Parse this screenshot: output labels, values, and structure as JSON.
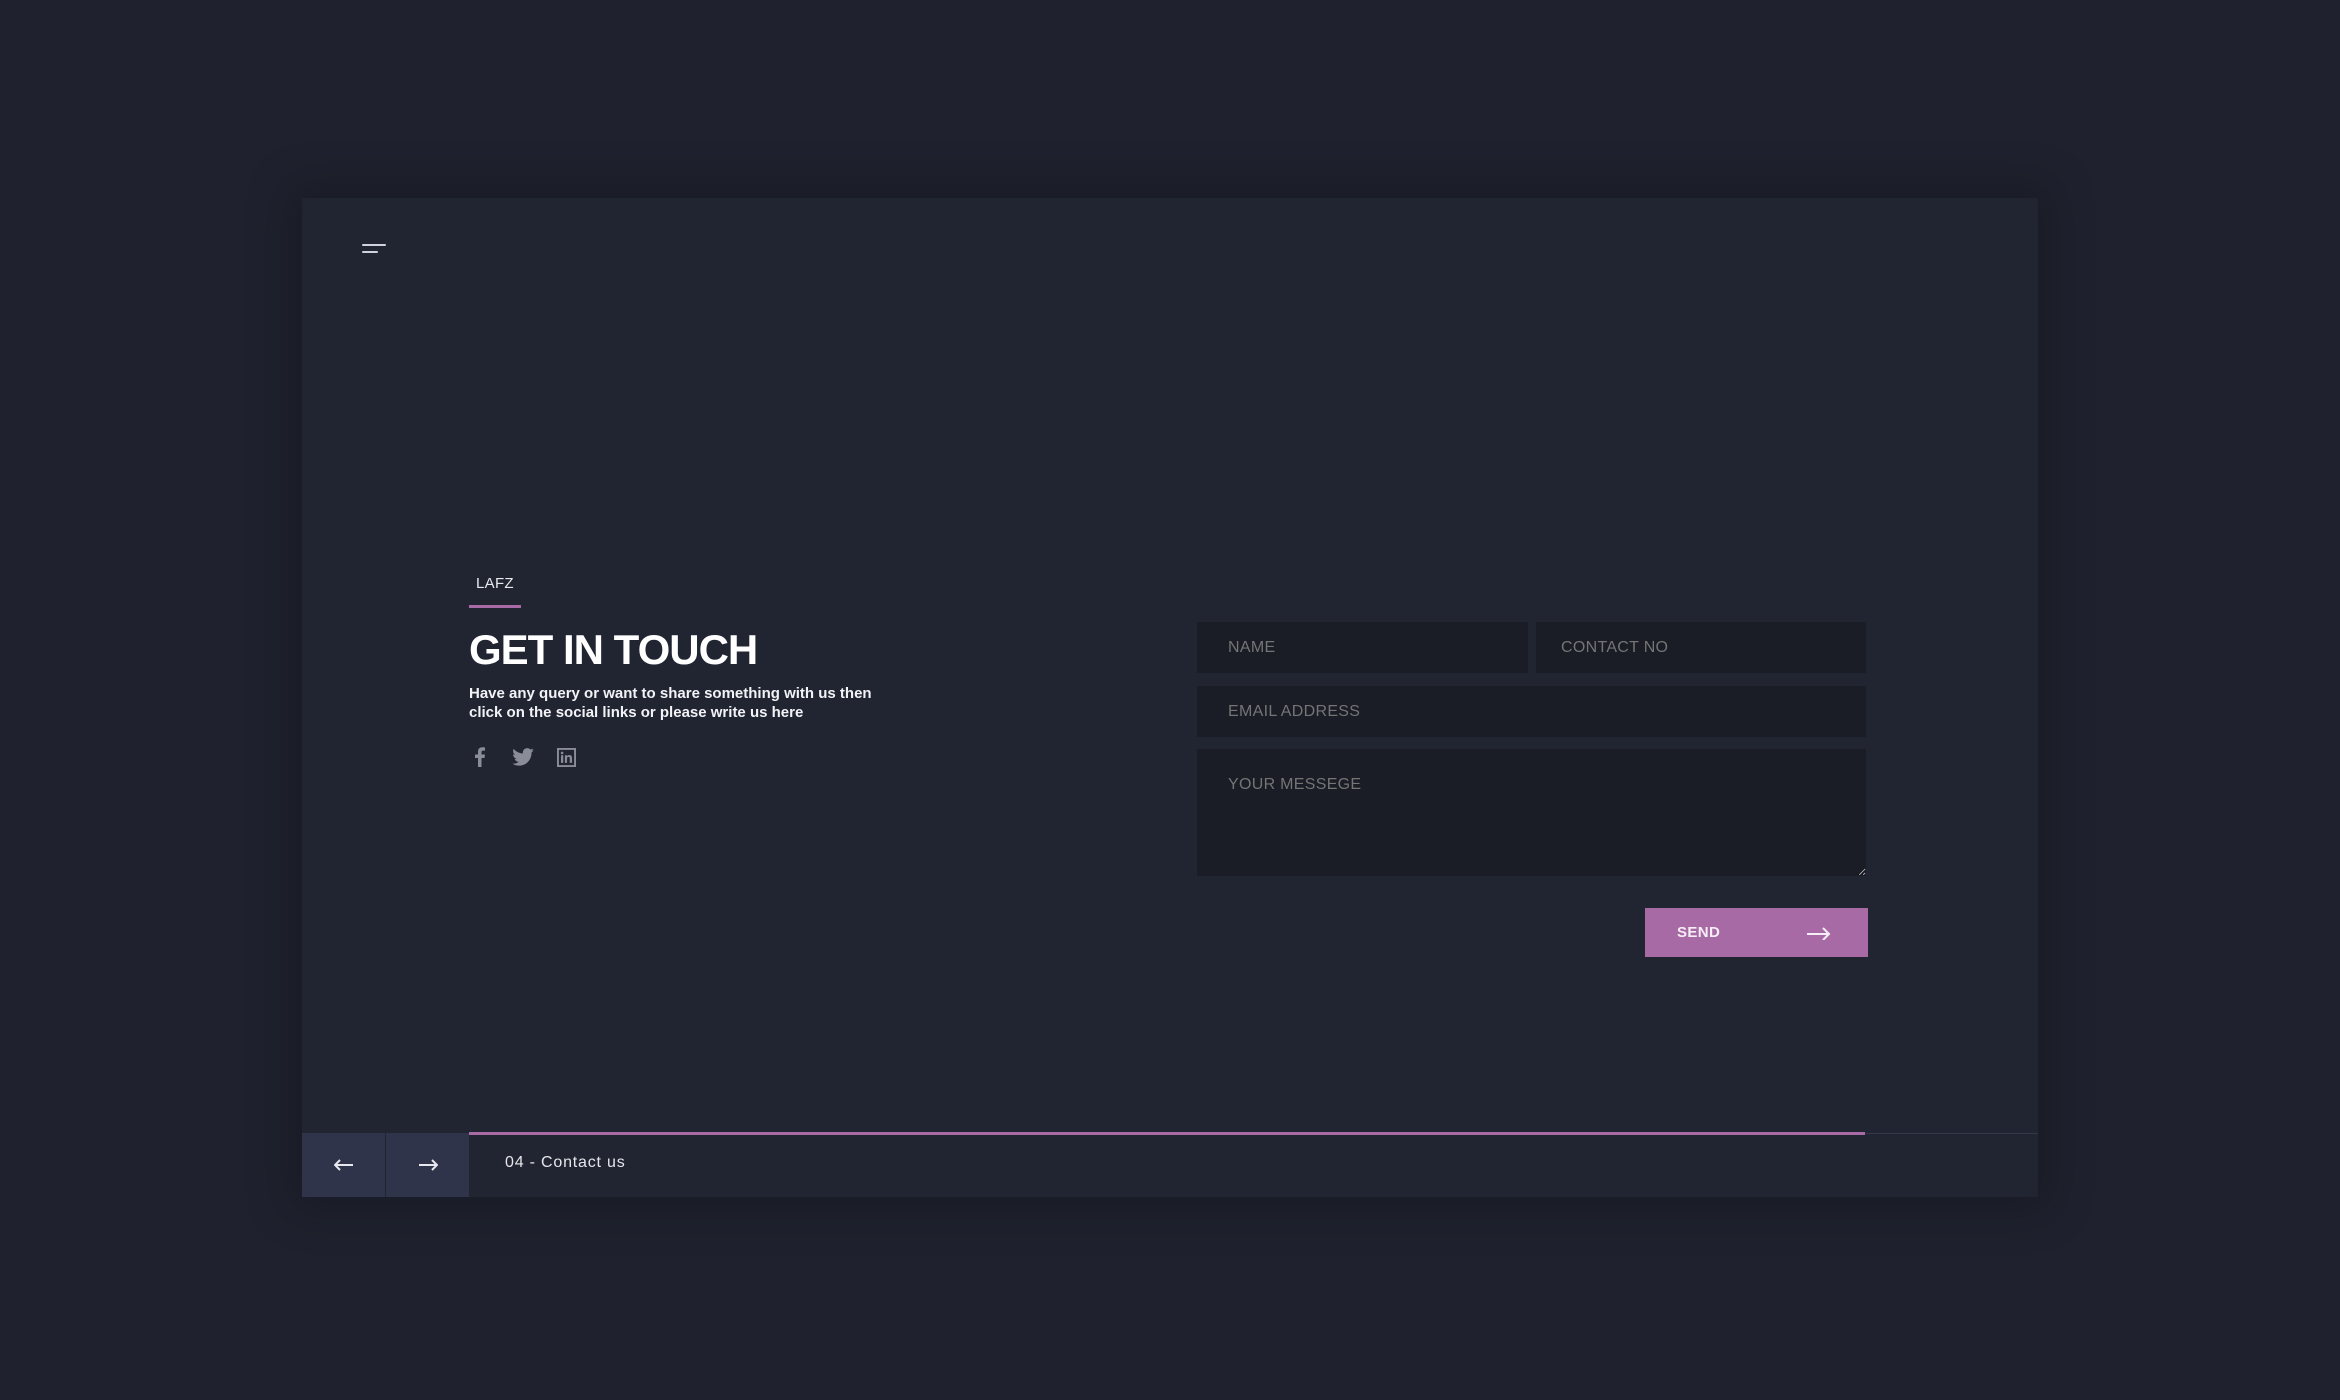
{
  "header": {
    "menu_icon": "hamburger-menu-icon"
  },
  "hero": {
    "brand": "LAFZ",
    "title": "GET IN TOUCH",
    "description_line1": "Have any query or want to share something with us then",
    "description_line2": "click on the social links or  please write us here",
    "social": [
      "facebook-icon",
      "twitter-icon",
      "linkedin-icon"
    ]
  },
  "form": {
    "name_placeholder": "NAME",
    "contact_placeholder": "CONTACT NO",
    "email_placeholder": "EMAIL ADDRESS",
    "message_placeholder": "YOUR MESSEGE",
    "send_label": "SEND",
    "send_icon": "arrow-right-icon"
  },
  "footer": {
    "prev_icon": "arrow-left-icon",
    "next_icon": "arrow-right-icon",
    "page_label": "04 - Contact us",
    "progress_fraction": 0.89
  },
  "colors": {
    "background": "#1f222e",
    "panel": "#212431",
    "field": "#1a1c26",
    "accent": "#a86aa4",
    "nav_button": "#30344a"
  }
}
